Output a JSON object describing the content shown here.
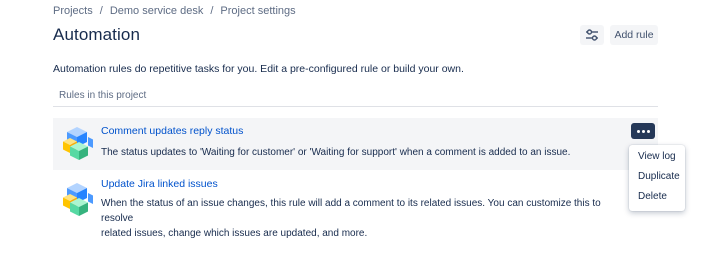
{
  "breadcrumb": {
    "items": [
      "Projects",
      "Demo service desk",
      "Project settings"
    ],
    "separator": "/"
  },
  "page": {
    "title": "Automation",
    "description": "Automation rules do repetitive tasks for you. Edit a pre-configured rule or build your own."
  },
  "toolbar": {
    "settings_icon": "sliders-icon",
    "add_rule_label": "Add rule"
  },
  "rules": {
    "section_label": "Rules in this project",
    "items": [
      {
        "title": "Comment updates reply status",
        "description": "The status updates to 'Waiting for customer' or 'Waiting for support' when a comment is added to an issue.",
        "icon": "cubes-icon"
      },
      {
        "title": "Update Jira linked issues",
        "description_line1": "When the status of an issue changes, this rule will add a comment to its related issues. You can customize this to resolve",
        "description_line2": "related issues, change which issues are updated, and more.",
        "icon": "cubes-icon"
      }
    ]
  },
  "menu": {
    "items": [
      "View log",
      "Duplicate",
      "Delete"
    ]
  },
  "colors": {
    "link": "#0052cc",
    "text": "#172b4d",
    "muted": "#5e6c84",
    "more_button": "#253858",
    "row_hover": "#f4f5f7"
  }
}
